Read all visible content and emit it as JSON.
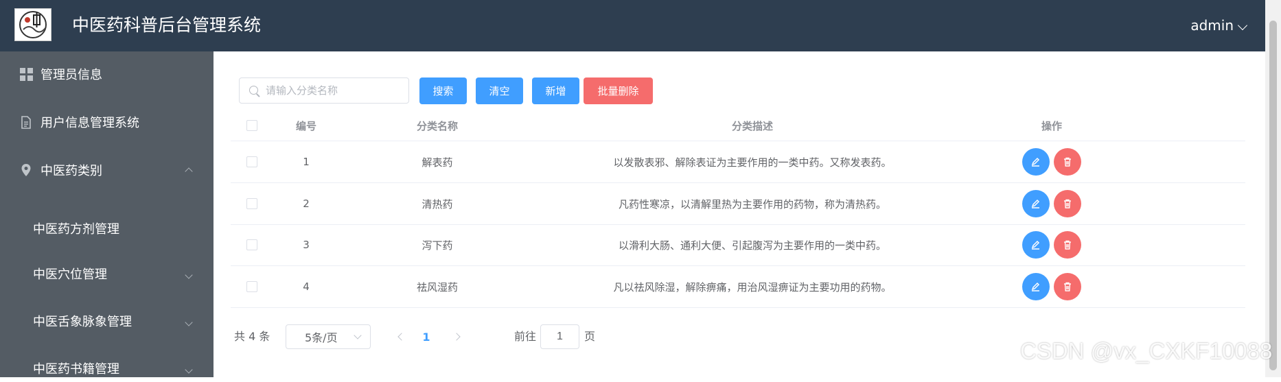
{
  "header": {
    "title": "中医药科普后台管理系统",
    "user": "admin"
  },
  "sidebar": {
    "items": [
      {
        "label": "管理员信息",
        "icon": "grid-icon"
      },
      {
        "label": "用户信息管理系统",
        "icon": "document-icon"
      },
      {
        "label": "中医药类别",
        "icon": "location-icon",
        "expanded": true
      },
      {
        "label": "中医药方剂管理",
        "sub": true
      },
      {
        "label": "中医穴位管理",
        "sub": true
      },
      {
        "label": "中医舌象脉象管理",
        "sub": true
      },
      {
        "label": "中医药书籍管理",
        "sub": true
      }
    ]
  },
  "toolbar": {
    "search_placeholder": "请输入分类名称",
    "search_label": "搜索",
    "clear_label": "清空",
    "add_label": "新增",
    "batch_delete_label": "批量删除"
  },
  "table": {
    "headers": {
      "id": "编号",
      "name": "分类名称",
      "desc": "分类描述",
      "ops": "操作"
    },
    "rows": [
      {
        "id": "1",
        "name": "解表药",
        "desc": "以发散表邪、解除表证为主要作用的一类中药。又称发表药。"
      },
      {
        "id": "2",
        "name": "清热药",
        "desc": "凡药性寒凉，以清解里热为主要作用的药物，称为清热药。"
      },
      {
        "id": "3",
        "name": "泻下药",
        "desc": "以滑利大肠、通利大便、引起腹泻为主要作用的一类中药。"
      },
      {
        "id": "4",
        "name": "祛风湿药",
        "desc": "凡以祛风除湿，解除痹痛，用治风湿痹证为主要功用的药物。"
      }
    ]
  },
  "pagination": {
    "total_text": "共 4 条",
    "page_size": "5条/页",
    "current_page": "1",
    "goto_label": "前往",
    "goto_value": "1",
    "page_suffix": "页"
  },
  "watermark": "CSDN @vx_CXKF10088",
  "colors": {
    "header_bg": "#2e3e50",
    "sidebar_bg": "#545c64",
    "primary": "#409eff",
    "danger": "#f56c6c"
  }
}
